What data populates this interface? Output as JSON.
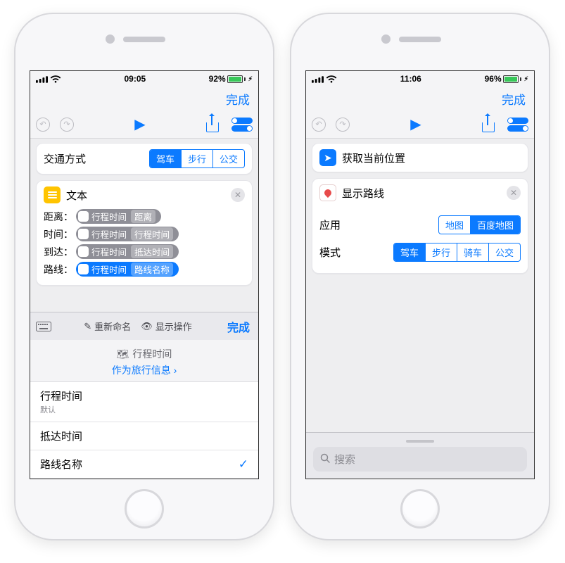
{
  "left": {
    "status": {
      "time": "09:05",
      "battery_pct": "92%",
      "battery_fill": 0.92
    },
    "nav": {
      "done": "完成"
    },
    "card_transport": {
      "label": "交通方式",
      "seg": [
        "驾车",
        "步行",
        "公交"
      ],
      "active_idx": 0
    },
    "text_card": {
      "title": "文本",
      "pill_app": "行程时间",
      "rows": [
        {
          "label": "距离：",
          "suffix": "距离",
          "selected": false
        },
        {
          "label": "时间：",
          "suffix": "行程时间",
          "selected": false
        },
        {
          "label": "到达：",
          "suffix": "抵达时间",
          "selected": false
        },
        {
          "label": "路线：",
          "suffix": "路线名称",
          "selected": true
        }
      ]
    },
    "kb": {
      "rename": "重新命名",
      "show": "显示操作",
      "done": "完成"
    },
    "panel": {
      "source": "行程时间",
      "link": "作为旅行信息",
      "items": [
        {
          "label": "行程时间",
          "sub": "默认",
          "checked": false
        },
        {
          "label": "抵达时间",
          "sub": "",
          "checked": false
        },
        {
          "label": "路线名称",
          "sub": "",
          "checked": true
        }
      ]
    }
  },
  "right": {
    "status": {
      "time": "11:06",
      "battery_pct": "96%",
      "battery_fill": 0.96
    },
    "nav": {
      "done": "完成"
    },
    "location_card": {
      "title": "获取当前位置"
    },
    "route_card": {
      "title": "显示路线",
      "rows": [
        {
          "label": "应用",
          "seg": [
            "地图",
            "百度地图"
          ],
          "active_idx": 1
        },
        {
          "label": "模式",
          "seg": [
            "驾车",
            "步行",
            "骑车",
            "公交"
          ],
          "active_idx": 0
        }
      ]
    },
    "search": {
      "placeholder": "搜索"
    }
  }
}
